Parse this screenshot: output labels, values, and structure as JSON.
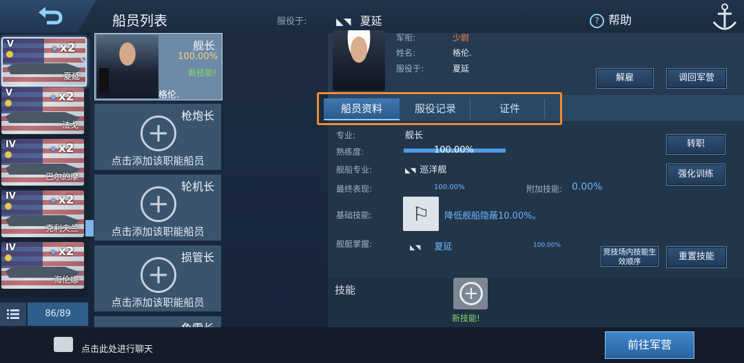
{
  "header": {
    "title": "船员列表",
    "served_label": "服役于:",
    "ship_name": "夏延",
    "help_label": "帮助"
  },
  "ships": [
    {
      "tier": "V",
      "multiplier": "x2",
      "name": "夏延"
    },
    {
      "tier": "V",
      "multiplier": "x2",
      "name": "法戈"
    },
    {
      "tier": "IV",
      "multiplier": "x2",
      "name": "巴尔的摩"
    },
    {
      "tier": "IV",
      "multiplier": "x2",
      "name": "克利夫兰"
    },
    {
      "tier": "IV",
      "multiplier": "x2",
      "name": "海伦娜"
    }
  ],
  "list_count": "86/89",
  "crew_slots": [
    {
      "title": "舰长",
      "percent": "100.00%",
      "status": "新技能!",
      "name": "格伦."
    },
    {
      "title": "枪炮长",
      "add_label": "点击添加该职能船员"
    },
    {
      "title": "轮机长",
      "add_label": "点击添加该职能船员"
    },
    {
      "title": "损管长",
      "add_label": "点击添加该职能船员"
    },
    {
      "title": "鱼雷长"
    }
  ],
  "profile": {
    "rank_label": "军衔:",
    "rank_value": "少尉",
    "name_label": "姓名:",
    "name_value": "格伦.",
    "served_label": "服役于:",
    "served_value": "夏延"
  },
  "buttons": {
    "dismiss": "解雇",
    "recall": "调回军营",
    "transfer": "转职",
    "train": "强化训练",
    "arena_order": "竞技场内技能生效顺序",
    "reset_skills": "重置技能",
    "goto_barracks": "前往军营"
  },
  "tabs": [
    "船员资料",
    "服役记录",
    "证件"
  ],
  "details": {
    "specialty_label": "专业:",
    "specialty_value": "舰长",
    "proficiency_label": "熟练度:",
    "proficiency_value": "100.00%",
    "proficiency_fraction": 1.0,
    "ship_specialty_label": "舰船专业:",
    "ship_specialty_value": "巡洋舰",
    "final_perf_label": "最终表现:",
    "final_perf_value": "100.00%",
    "extra_skill_label": "附加技能:",
    "extra_skill_value": "0.00%",
    "base_skill_label": "基础技能:",
    "base_skill_value": "降低舰船隐蔽10.00%。",
    "ship_mastery_label": "舰艇掌握:",
    "ship_mastery_ship": "夏延",
    "ship_mastery_value": "100.00%"
  },
  "skills": {
    "label": "技能",
    "new_skill": "新技能!"
  },
  "chat": {
    "text": "点击此处进行聊天"
  }
}
